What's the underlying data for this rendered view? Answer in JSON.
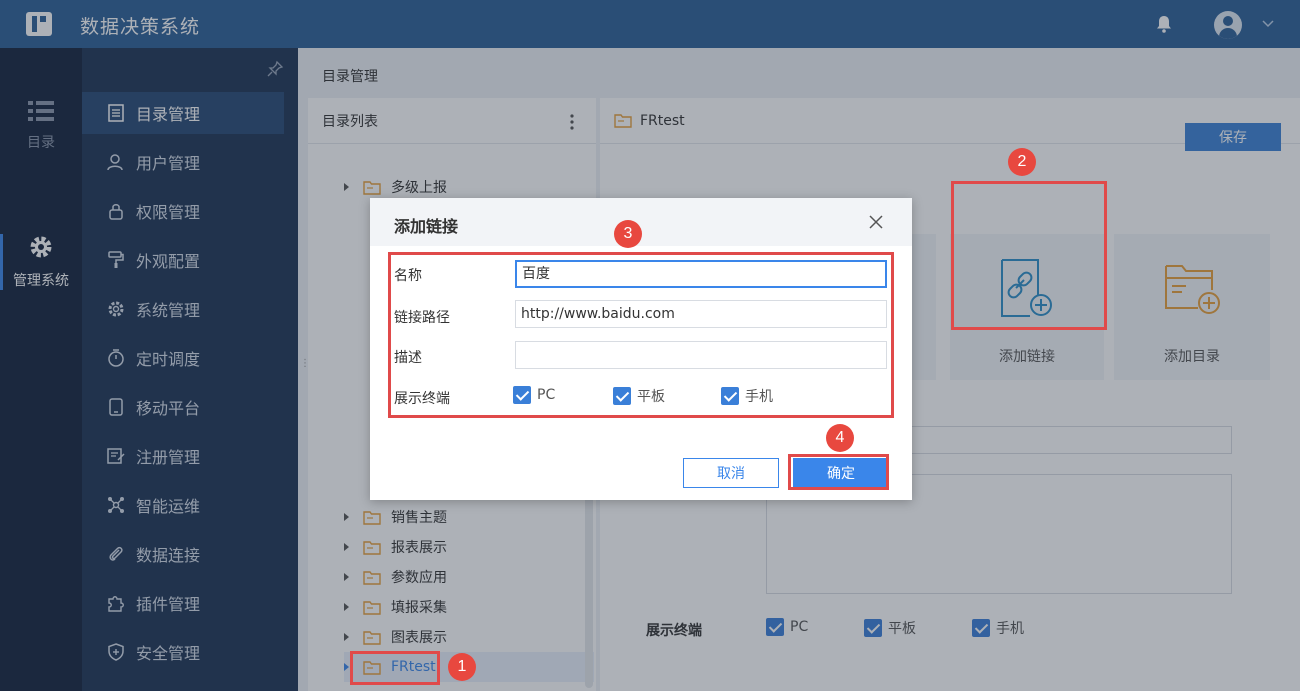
{
  "header": {
    "title": "数据决策系统"
  },
  "rail": [
    {
      "label": "目录",
      "icon": "list-icon"
    },
    {
      "label": "管理系统",
      "icon": "gear-icon"
    }
  ],
  "menu": [
    {
      "label": "目录管理",
      "icon": "catalog-icon"
    },
    {
      "label": "用户管理",
      "icon": "user-icon"
    },
    {
      "label": "权限管理",
      "icon": "lock-icon"
    },
    {
      "label": "外观配置",
      "icon": "paint-roller-icon"
    },
    {
      "label": "系统管理",
      "icon": "gear-icon"
    },
    {
      "label": "定时调度",
      "icon": "timer-icon"
    },
    {
      "label": "移动平台",
      "icon": "mobile-icon"
    },
    {
      "label": "注册管理",
      "icon": "register-icon"
    },
    {
      "label": "智能运维",
      "icon": "nodes-icon"
    },
    {
      "label": "数据连接",
      "icon": "paperclip-icon"
    },
    {
      "label": "插件管理",
      "icon": "puzzle-icon"
    },
    {
      "label": "安全管理",
      "icon": "shield-icon"
    }
  ],
  "breadcrumb": "目录管理",
  "tree": {
    "header": "目录列表",
    "items": [
      {
        "label": "多级上报"
      },
      {
        "label": "销售主题"
      },
      {
        "label": "报表展示"
      },
      {
        "label": "参数应用"
      },
      {
        "label": "填报采集"
      },
      {
        "label": "图表展示"
      },
      {
        "label": "FRtest"
      }
    ]
  },
  "detail": {
    "title": "FRtest",
    "save_label": "保存",
    "cards": [
      {
        "label": "添加链接",
        "icon": "add-link-icon"
      },
      {
        "label": "添加目录",
        "icon": "add-folder-icon"
      }
    ],
    "terminal_label": "展示终端",
    "terminals": [
      "PC",
      "平板",
      "手机"
    ]
  },
  "dialog": {
    "title": "添加链接",
    "fields": {
      "name_label": "名称",
      "name_value": "百度",
      "path_label": "链接路径",
      "path_value": "http://www.baidu.com",
      "desc_label": "描述",
      "desc_value": "",
      "terminal_label": "展示终端"
    },
    "terminals": [
      "PC",
      "平板",
      "手机"
    ],
    "cancel_label": "取消",
    "ok_label": "确定"
  },
  "annotations": [
    "1",
    "2",
    "3",
    "4"
  ],
  "colors": {
    "header": "#2d5f97",
    "accent": "#3a86ea",
    "highlight": "#e04a4a",
    "folder": "#e8a03a"
  }
}
